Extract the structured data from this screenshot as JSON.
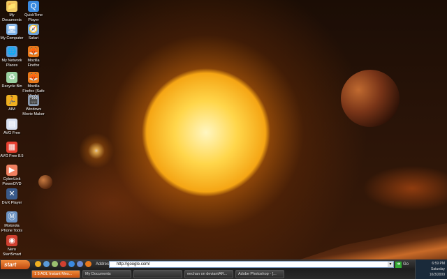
{
  "desktop": {
    "icons": [
      {
        "label": "My Documents",
        "icon": "folder-icon",
        "color": "#f0c860",
        "glyph": "📁"
      },
      {
        "label": "My Computer",
        "icon": "computer-icon",
        "color": "#7ab0e8",
        "glyph": "🖥"
      },
      {
        "label": "My Network Places",
        "icon": "network-icon",
        "color": "#5a9ad8",
        "glyph": "🌐"
      },
      {
        "label": "Recycle Bin",
        "icon": "recycle-bin-icon",
        "color": "#9ad0a0",
        "glyph": "♻"
      },
      {
        "label": "AIM",
        "icon": "aim-icon",
        "color": "#f0b020",
        "glyph": "🏃"
      },
      {
        "label": "AVG Free",
        "icon": "avg-icon",
        "color": "#d8e0f0",
        "glyph": "▤"
      },
      {
        "label": "AVG Free 8.5",
        "icon": "avg-icon",
        "color": "#e84030",
        "glyph": "▦"
      },
      {
        "label": "CyberLink PowerDVD",
        "icon": "powerdvd-icon",
        "color": "#f08060",
        "glyph": "▶"
      },
      {
        "label": "DivX Player",
        "icon": "divx-icon",
        "color": "#3a5a8a",
        "glyph": "✕"
      },
      {
        "label": "Motorola Phone Tools",
        "icon": "motorola-icon",
        "color": "#6a90c0",
        "glyph": "Ⓜ"
      },
      {
        "label": "Nero StartSmart",
        "icon": "nero-icon",
        "color": "#d04030",
        "glyph": "◉"
      },
      {
        "label": "QuickTime Player",
        "icon": "quicktime-icon",
        "color": "#3a8ae0",
        "glyph": "Q"
      },
      {
        "label": "Safari",
        "icon": "safari-icon",
        "color": "#6aa0d8",
        "glyph": "🧭"
      },
      {
        "label": "Mozilla Firefox",
        "icon": "firefox-icon",
        "color": "#e8781a",
        "glyph": "🦊"
      },
      {
        "label": "Mozilla Firefox (Safe Mode)",
        "icon": "firefox-icon",
        "color": "#e8781a",
        "glyph": "🦊"
      },
      {
        "label": "Windows Movie Maker",
        "icon": "movie-maker-icon",
        "color": "#8a9ab0",
        "glyph": "🎬"
      }
    ]
  },
  "taskbar": {
    "start_label": "start",
    "quick_launch": [
      {
        "icon": "aim-icon",
        "color": "#f0b020"
      },
      {
        "icon": "network-icon",
        "color": "#5a9ad8"
      },
      {
        "icon": "recycle-icon",
        "color": "#9ac070"
      },
      {
        "icon": "nero-icon",
        "color": "#d04030"
      },
      {
        "icon": "messenger-icon",
        "color": "#3a8ae0"
      },
      {
        "icon": "window-icon",
        "color": "#6a8ad0"
      },
      {
        "icon": "firefox-icon",
        "color": "#e8781a"
      }
    ],
    "address_label": "Address",
    "address_value": "http://google.com/",
    "go_label": "Go",
    "tasks": [
      {
        "label": "1 5 AOL Instant Mes...",
        "active": true
      },
      {
        "label": "My Documents",
        "active": false
      },
      {
        "label": "",
        "active": false
      },
      {
        "label": "eechan on deviantAR...",
        "active": false
      },
      {
        "label": "Adobe Photoshop - [...",
        "active": false
      }
    ],
    "clock": {
      "time": "6:59 PM",
      "day": "Saturday",
      "date": "10/3/2009"
    }
  }
}
